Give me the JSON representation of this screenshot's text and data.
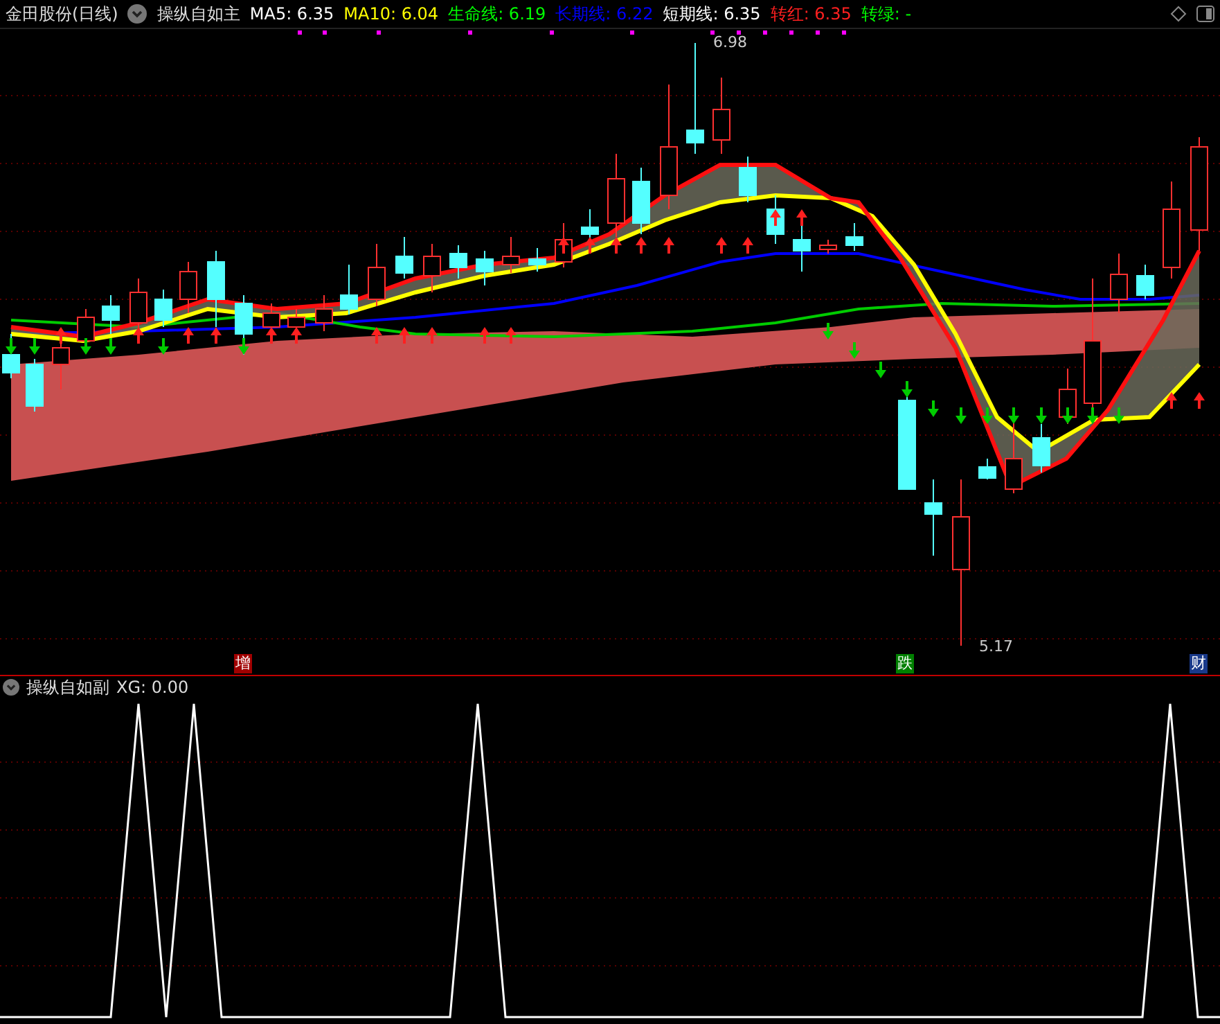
{
  "main_panel": {
    "stock": "金田股份(日线)",
    "indicator": "操纵自如主",
    "legend": [
      {
        "text": "MA5: 6.35",
        "color": "#ffffff"
      },
      {
        "text": "MA10: 6.04",
        "color": "#ffff00"
      },
      {
        "text": "生命线: 6.19",
        "color": "#00ff00"
      },
      {
        "text": "长期线: 6.22",
        "color": "#0000ff"
      },
      {
        "text": "短期线: 6.35",
        "color": "#ffffff"
      },
      {
        "text": "转红: 6.35",
        "color": "#ff2020"
      },
      {
        "text": "转绿: -",
        "color": "#00ff00"
      }
    ],
    "price_labels": [
      "6.98",
      "5.17"
    ],
    "markers": [
      {
        "text": "增",
        "color": "#a00000"
      },
      {
        "text": "跌",
        "color": "#008000"
      },
      {
        "text": "财",
        "color": "#1a3a8a"
      }
    ]
  },
  "sub_panel": {
    "indicator": "操纵自如副",
    "reading": "XG: 0.00"
  }
}
